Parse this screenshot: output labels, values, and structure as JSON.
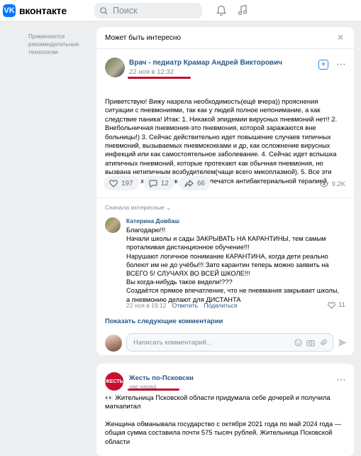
{
  "header": {
    "logo_letter": "VK",
    "logo_text": "вконтакте",
    "search_placeholder": "Поиск"
  },
  "sidebar": {
    "note": "Применяются рекомендательные технологии"
  },
  "feed": {
    "block_title": "Может быть интересно",
    "close_glyph": "✕",
    "post": {
      "author": "Врач - педиатр Крамар Андрей Викторович",
      "date": "22 ноя в 12:32",
      "text": "Приветствую! Вижу назрела необходимость(ещё вчера)) прояснения ситуации с пневмониями, так как у людей полное непонимание, а как следствие паника! Итак: 1. Никакой эпидемии вирусных пневмоний нет!! 2. Внебольничная пневмония-это пневмония, которой заражаются вне больницы!) 3. Сейчас действительно идет повышение случаев типичных пневмоний, вызываемых пневмококками и др, как осложнение вирусных инфекций или как самостоятельное заболевание. 4. Сейчас идет вспышка атипичных пневмоний, которые протекают как обычная пневмония, но вызвана нетипичным возбудителем(чаще всего микоплазмой). 5. Все эти пневмонии хорошо (как правило) лечатся антибактериальной терапией.",
      "likes": "197",
      "comments": "12",
      "shares": "66",
      "views": "9.2K"
    },
    "comments_sort": "Сначала интересные",
    "comment": {
      "author": "Катерина Довбаш",
      "lines": [
        "Благодарю!!!",
        "Начали школы и сады ЗАКРЫВАТЬ НА КАРАНТИНЫ, тем самым проталкивая дистанционное обучение!!!",
        "Нарушают логичное понимание КАРАНТИНА, когда дети реально болеют им не до учёбы!!! Зато карантин теперь можно заявить на ВСЕГО 5! СЛУЧАЯХ ВО ВСЕЙ ШКОЛЕ!!!",
        "Вы когда-нибудь такое видели!???",
        "Создаётся прямое впечатление, что не пневмания закрывает школы, а пневмонию делают для ДИСТАНТА"
      ],
      "date": "22 ноя в 19:12",
      "reply": "Ответить",
      "share": "Поделиться",
      "likes": "11"
    },
    "show_more": "Показать следующие комментарии",
    "comment_placeholder": "Написать комментарий...",
    "post2": {
      "avatar_text": "ЖЕСТЬ",
      "author": "Жесть по-Псковски",
      "date": "час назад",
      "line1": "👀 Жительница Псковской области придумала себе дочерей и получила маткапитал",
      "line2": "Женщина обманывала государство с октября 2021 года по май 2024 года — общая сумма составила почти 575 тысяч рублей. Жительница Псковской области"
    }
  },
  "colors": {
    "accent": "#0077ff",
    "link": "#2a5885",
    "annotation_underline": "#c8102e"
  }
}
